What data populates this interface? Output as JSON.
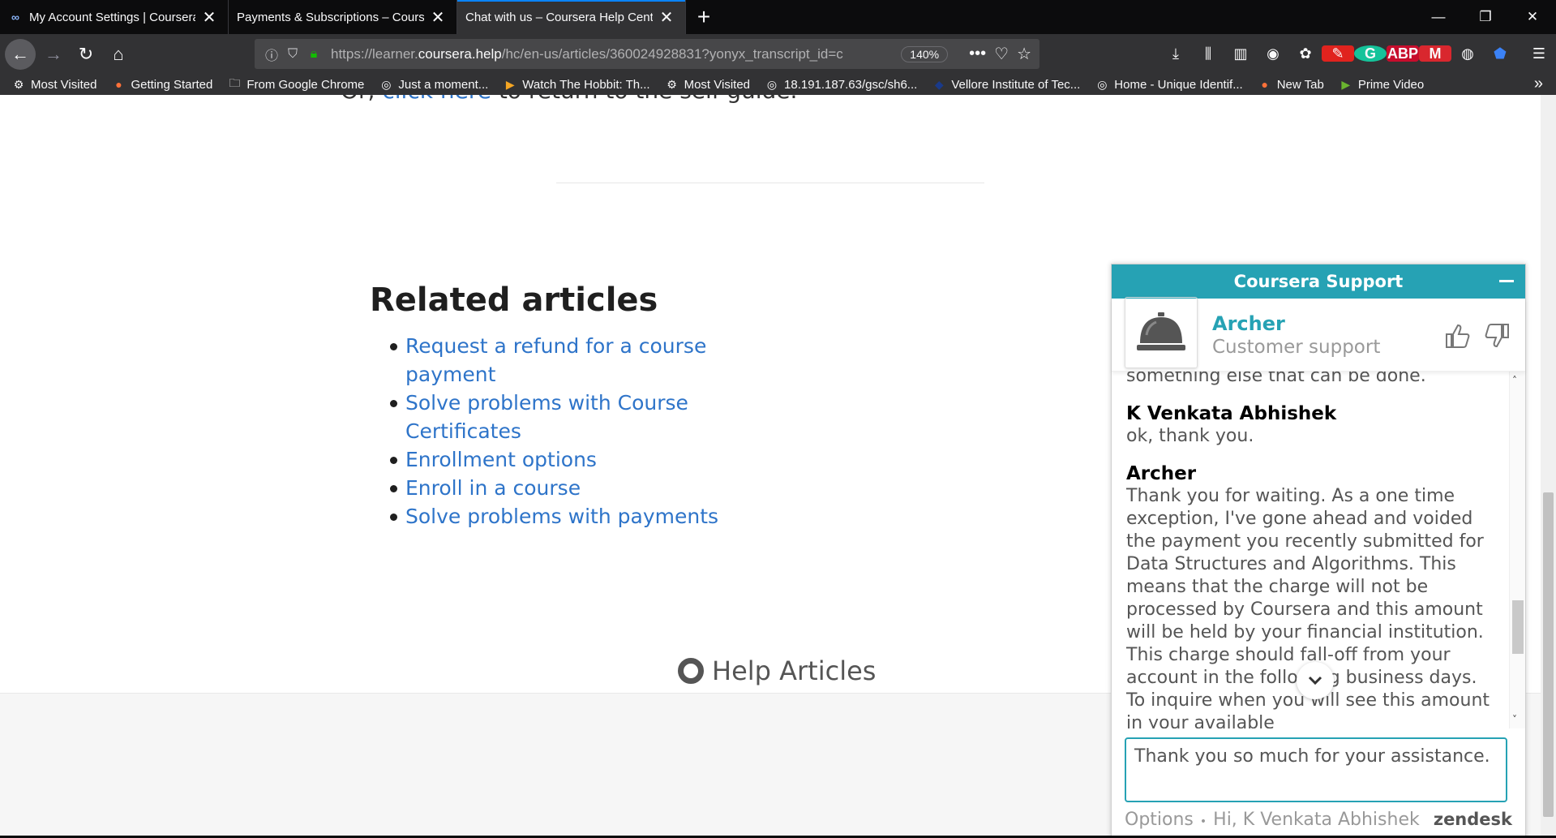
{
  "tabs": [
    {
      "label": "My Account Settings | Coursera",
      "icon": "coursera-logo-icon",
      "active": false
    },
    {
      "label": "Payments & Subscriptions – Coursera",
      "icon": "",
      "active": false
    },
    {
      "label": "Chat with us – Coursera Help Center",
      "icon": "",
      "active": true
    }
  ],
  "nav": {
    "url_prefix": "https://learner.",
    "url_domain": "coursera.help",
    "url_rest": "/hc/en-us/articles/360024928831?yonyx_transcript_id=c",
    "zoom": "140%"
  },
  "bookmarks": [
    {
      "label": "Most Visited",
      "icon": "gear-icon"
    },
    {
      "label": "Getting Started",
      "icon": "firefox-icon"
    },
    {
      "label": "From Google Chrome",
      "icon": "folder-icon"
    },
    {
      "label": "Just a moment...",
      "icon": "globe-icon"
    },
    {
      "label": "Watch The Hobbit: Th...",
      "icon": "play-icon"
    },
    {
      "label": "Most Visited",
      "icon": "gear-icon"
    },
    {
      "label": "18.191.187.63/gsc/sh6...",
      "icon": "globe-icon"
    },
    {
      "label": "Vellore Institute of Tec...",
      "icon": "vit-icon"
    },
    {
      "label": "Home - Unique Identif...",
      "icon": "globe-icon"
    },
    {
      "label": "New Tab",
      "icon": "firefox-icon"
    },
    {
      "label": "Prime Video",
      "icon": "play-icon"
    }
  ],
  "page": {
    "cutoff_prefix": "Or, ",
    "cutoff_link": "click here",
    "cutoff_suffix": " to return to the self-guide.",
    "related_title": "Related articles",
    "related_articles": [
      "Request a refund for a course payment",
      "Solve problems with Course Certificates",
      "Enrollment options",
      "Enroll in a course",
      "Solve problems with payments"
    ],
    "footer_link": "Help Articles"
  },
  "chat": {
    "header": "Coursera Support",
    "agent_name": "Archer",
    "agent_role": "Customer support",
    "prev_text": "something else that can be done.",
    "messages": [
      {
        "author": "K Venkata Abhishek",
        "text": "ok, thank you."
      },
      {
        "author": "Archer",
        "text": "Thank you for waiting. As a one time exception, I've gone ahead and voided the payment you recently submitted for  Data Structures and Algorithms. This means that the charge will not be processed by Coursera and this amount will be held by your financial institution. This charge should fall-off from your account in the following business days. To inquire when you will see this amount in your available"
      }
    ],
    "composer_text": "Thank you so much for your assistance.",
    "footer_options": "Options",
    "footer_separator": "•",
    "footer_greeting": "Hi, K Venkata Abhishek",
    "footer_brand": "zendesk"
  },
  "colors": {
    "chat_accent": "#26a2b4",
    "link": "#2e74c9",
    "active_tab_line": "#0a84ff"
  }
}
